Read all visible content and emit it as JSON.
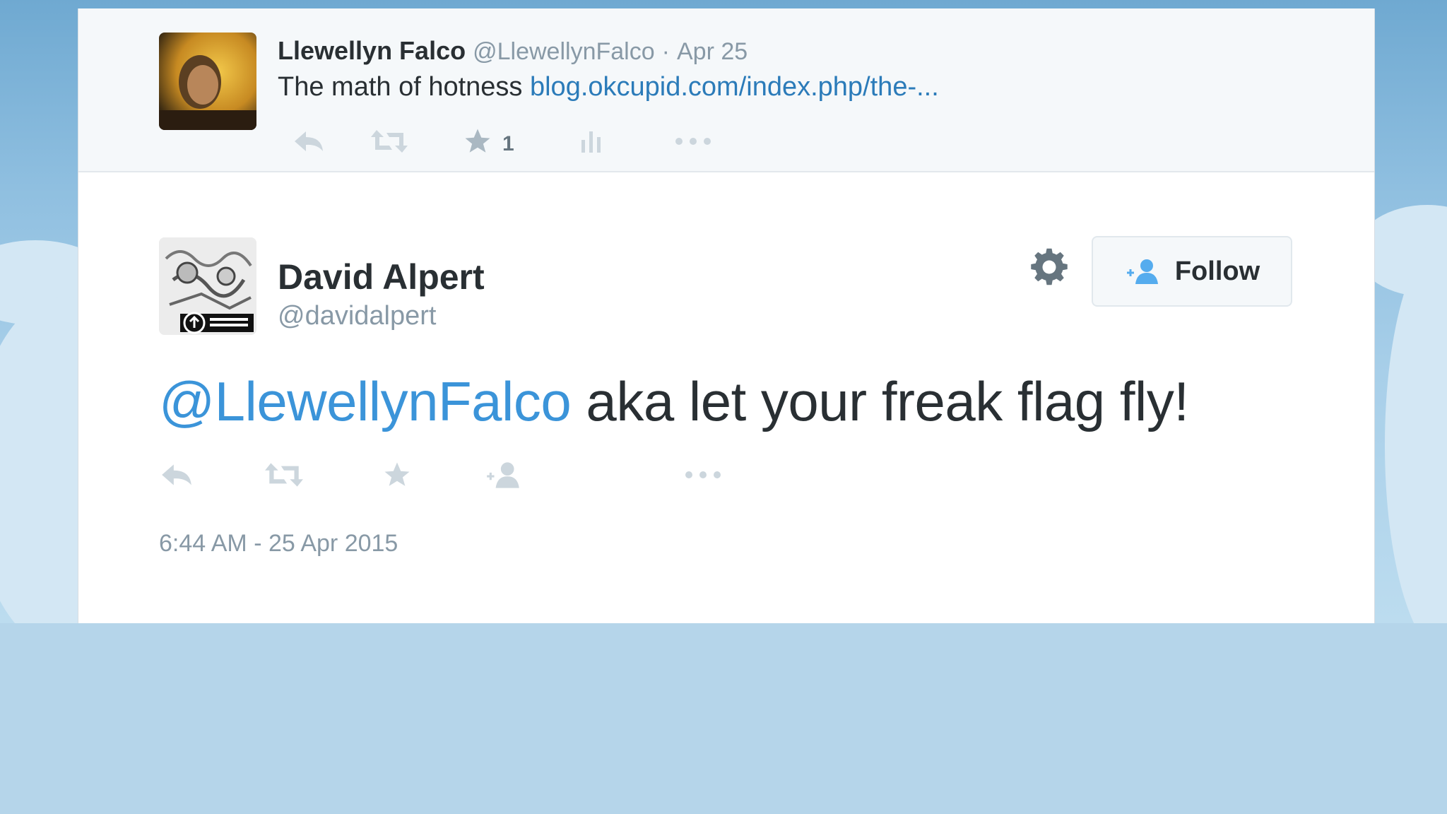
{
  "parent_tweet": {
    "author_name": "Llewellyn Falco",
    "author_handle": "@LlewellynFalco",
    "separator": "·",
    "date": "Apr 25",
    "text": "The math of hotness",
    "link_text": "blog.okcupid.com/index.php/the-...",
    "favorite_count": "1",
    "icons": [
      "reply-icon",
      "retweet-icon",
      "favorite-icon",
      "analytics-icon",
      "more-icon"
    ]
  },
  "tweet": {
    "author_name": "David Alpert",
    "author_handle": "@davidalpert",
    "follow_label": "Follow",
    "mention": "@LlewellynFalco",
    "text": " aka let your freak flag fly!",
    "timestamp": "6:44 AM - 25 Apr 2015",
    "icons": [
      "reply-icon",
      "retweet-icon",
      "favorite-icon",
      "follow-user-icon",
      "more-icon"
    ]
  },
  "colors": {
    "link": "#2b7bb9",
    "mention": "#3b94d9",
    "muted": "#8899a6",
    "text": "#292f33",
    "icon_light": "#ccd6dd",
    "follow_icon": "#55acee"
  }
}
